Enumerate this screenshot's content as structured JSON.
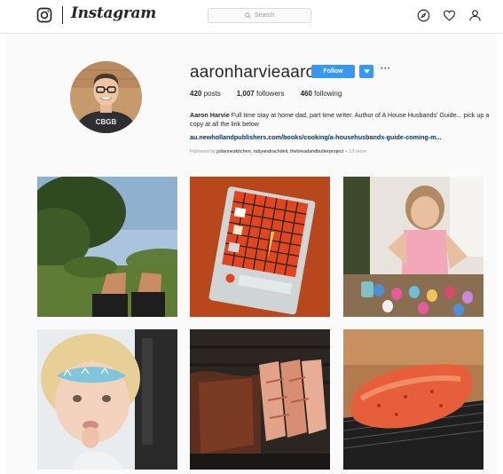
{
  "nav": {
    "wordmark": "Instagram",
    "search_placeholder": "Search",
    "icons": [
      "instagram-camera-icon",
      "compass-icon",
      "heart-icon",
      "profile-icon",
      "search-icon"
    ]
  },
  "profile": {
    "username": "aaronharvieaaron",
    "follow_label": "Follow",
    "more_label": "···",
    "stats": {
      "posts_count": "420",
      "posts_label": "posts",
      "followers_count": "1,007",
      "followers_label": "followers",
      "following_count": "460",
      "following_label": "following"
    },
    "bio_name": "Aaron Harvie",
    "bio_text": "Full time stay at home dad, part time writer. Author of A House Husbands' Guide... pick up a copy at all the link below",
    "bio_link": "au.newhollandpublishers.com/books/cooking/a-househusbands-guide-coming-m...",
    "followed_by_label": "Followed by",
    "followed_by_accounts": "julianneskitchen, rubyandrachdeli, thebreadandbutterproject",
    "followed_by_more": "+ 13 more",
    "avatar_shirt_text": "CBGB"
  },
  "posts": [
    {
      "subject": "legs-on-grass-with-tree"
    },
    {
      "subject": "red-notebook-with-stickers"
    },
    {
      "subject": "child-with-easter-eggs"
    },
    {
      "subject": "child-with-face-paint"
    },
    {
      "subject": "sliced-brisket-on-grill"
    },
    {
      "subject": "raw-meat-on-rack"
    }
  ],
  "colors": {
    "follow_button": "#3897f0",
    "link": "#003569",
    "page_background": "#fafafa"
  }
}
